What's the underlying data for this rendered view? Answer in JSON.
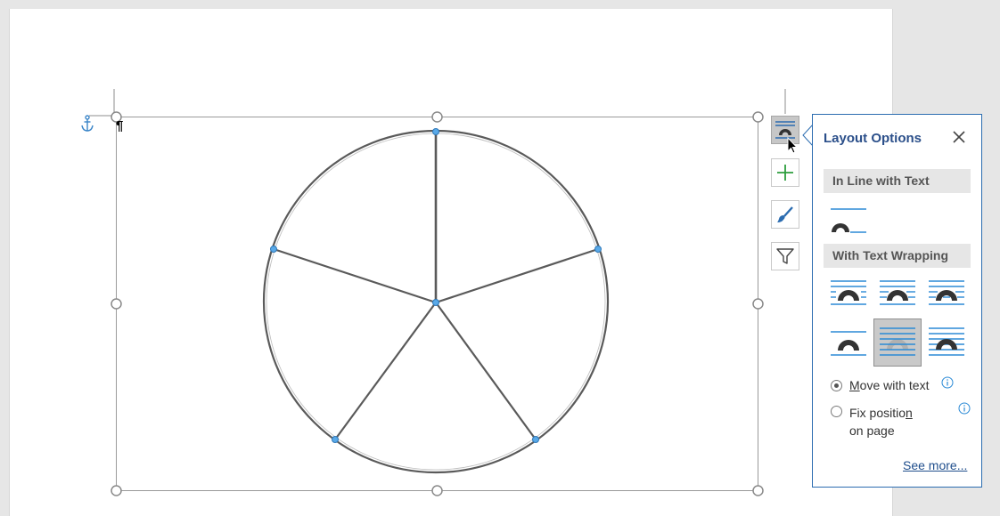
{
  "document": {
    "pilcrow": "¶"
  },
  "side_buttons": [
    {
      "icon": "layout-options-icon",
      "active": true
    },
    {
      "icon": "plus-icon",
      "color": "#2e9e3e"
    },
    {
      "icon": "brush-icon",
      "color": "#2b6cb0"
    },
    {
      "icon": "filter-icon"
    }
  ],
  "layout_options": {
    "title": "Layout Options",
    "close_icon": "close-icon",
    "inline_section": "In Line with Text",
    "wrapping_section": "With Text Wrapping",
    "wrap_options": [
      {
        "icon": "in-line-with-text-icon"
      },
      {
        "icon": "square-wrap-icon"
      },
      {
        "icon": "tight-wrap-icon"
      },
      {
        "icon": "through-wrap-icon"
      },
      {
        "icon": "top-and-bottom-wrap-icon"
      },
      {
        "icon": "behind-text-icon",
        "selected": true
      },
      {
        "icon": "in-front-of-text-icon"
      }
    ],
    "move_with_text": {
      "pre": "",
      "accel": "M",
      "post": "ove with text",
      "checked": true
    },
    "fix_position": {
      "pre": "Fix positio",
      "accel": "n",
      "post": " on page",
      "checked": false
    },
    "see_more": "See more..."
  },
  "colors": {
    "accent": "#2b6cb0",
    "handle_blue": "#59a9e8",
    "selected_bg": "#c9c9c9"
  }
}
